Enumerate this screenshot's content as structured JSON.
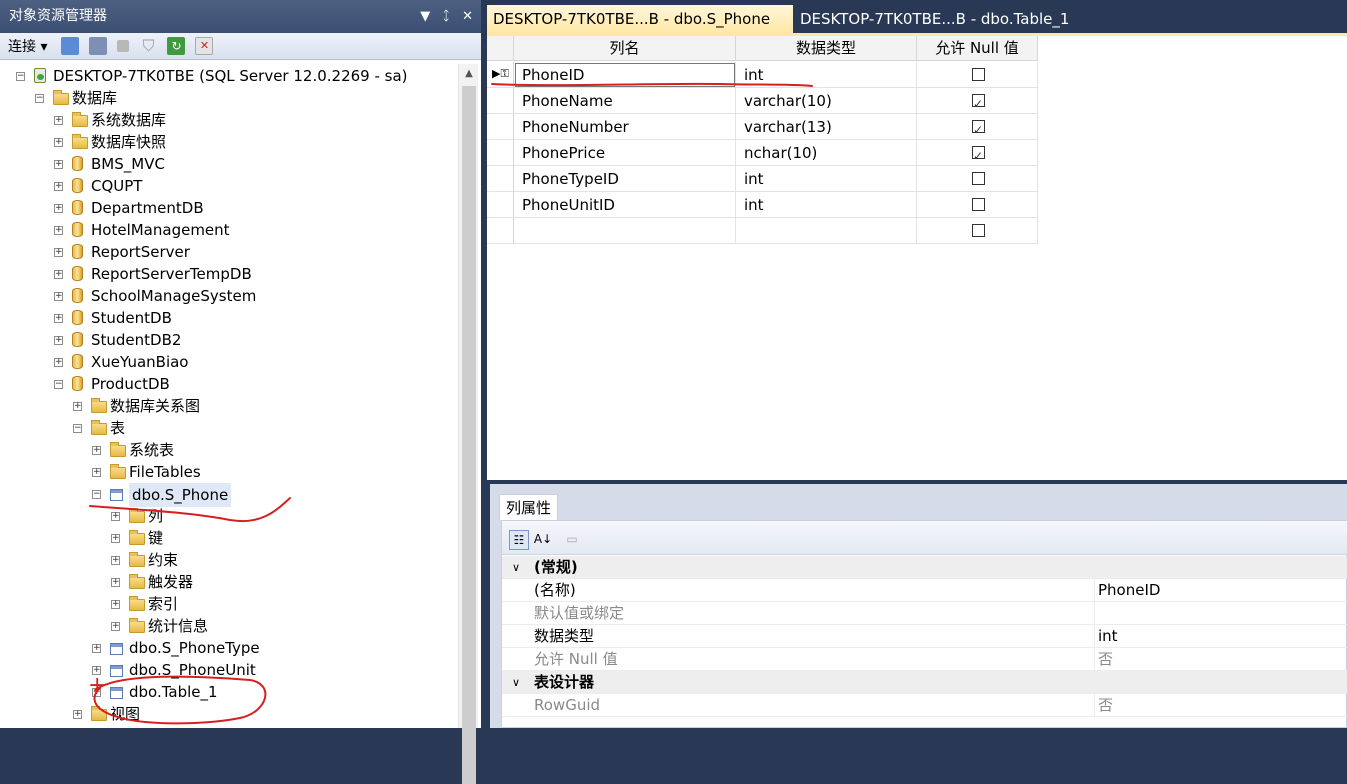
{
  "object_explorer": {
    "title": "对象资源管理器",
    "pin": "▾ ᛨ ✕",
    "toolbar": {
      "connect_label": "连接"
    },
    "tree": [
      {
        "label": "DESKTOP-7TK0TBE (SQL Server 12.0.2269 - sa)",
        "icon": "server-icon",
        "exp": "m"
      },
      {
        "label": "数据库",
        "icon": "folder-icon",
        "exp": "m"
      },
      {
        "label": "系统数据库",
        "icon": "folder-icon",
        "exp": "p"
      },
      {
        "label": "数据库快照",
        "icon": "folder-icon",
        "exp": "p"
      },
      {
        "label": "BMS_MVC",
        "icon": "database-icon",
        "exp": "p"
      },
      {
        "label": "CQUPT",
        "icon": "database-icon",
        "exp": "p"
      },
      {
        "label": "DepartmentDB",
        "icon": "database-icon",
        "exp": "p"
      },
      {
        "label": "HotelManagement",
        "icon": "database-icon",
        "exp": "p"
      },
      {
        "label": "ReportServer",
        "icon": "database-icon",
        "exp": "p"
      },
      {
        "label": "ReportServerTempDB",
        "icon": "database-icon",
        "exp": "p"
      },
      {
        "label": "SchoolManageSystem",
        "icon": "database-icon",
        "exp": "p"
      },
      {
        "label": "StudentDB",
        "icon": "database-icon",
        "exp": "p"
      },
      {
        "label": "StudentDB2",
        "icon": "database-icon",
        "exp": "p"
      },
      {
        "label": "XueYuanBiao",
        "icon": "database-icon",
        "exp": "p"
      },
      {
        "label": "ProductDB",
        "icon": "database-icon",
        "exp": "m"
      },
      {
        "label": "数据库关系图",
        "icon": "folder-icon",
        "exp": "p"
      },
      {
        "label": "表",
        "icon": "folder-icon",
        "exp": "m"
      },
      {
        "label": "系统表",
        "icon": "folder-icon",
        "exp": "p"
      },
      {
        "label": "FileTables",
        "icon": "folder-icon",
        "exp": "p"
      },
      {
        "label": "dbo.S_Phone",
        "icon": "table-icon",
        "exp": "m",
        "selected": true
      },
      {
        "label": "列",
        "icon": "folder-icon",
        "exp": "p"
      },
      {
        "label": "键",
        "icon": "folder-icon",
        "exp": "p"
      },
      {
        "label": "约束",
        "icon": "folder-icon",
        "exp": "p"
      },
      {
        "label": "触发器",
        "icon": "folder-icon",
        "exp": "p"
      },
      {
        "label": "索引",
        "icon": "folder-icon",
        "exp": "p"
      },
      {
        "label": "统计信息",
        "icon": "folder-icon",
        "exp": "p"
      },
      {
        "label": "dbo.S_PhoneType",
        "icon": "table-icon",
        "exp": "p"
      },
      {
        "label": "dbo.S_PhoneUnit",
        "icon": "table-icon",
        "exp": "p"
      },
      {
        "label": "dbo.Table_1",
        "icon": "table-icon",
        "exp": "p"
      },
      {
        "label": "视图",
        "icon": "folder-icon",
        "exp": "p"
      }
    ]
  },
  "tabs": [
    {
      "label": "DESKTOP-7TK0TBE...B - dbo.S_Phone",
      "active": true
    },
    {
      "label": "DESKTOP-7TK0TBE...B - dbo.Table_1",
      "active": false
    }
  ],
  "designer": {
    "headers": [
      "列名",
      "数据类型",
      "允许 Null 值"
    ],
    "rows": [
      {
        "name": "PhoneID",
        "type": "int",
        "allow_null": false,
        "primary_key": true
      },
      {
        "name": "PhoneName",
        "type": "varchar(10)",
        "allow_null": true
      },
      {
        "name": "PhoneNumber",
        "type": "varchar(13)",
        "allow_null": true
      },
      {
        "name": "PhonePrice",
        "type": "nchar(10)",
        "allow_null": true
      },
      {
        "name": "PhoneTypeID",
        "type": "int",
        "allow_null": false
      },
      {
        "name": "PhoneUnitID",
        "type": "int",
        "allow_null": false
      },
      {
        "name": "",
        "type": "",
        "allow_null": false
      }
    ]
  },
  "properties": {
    "tab_label": "列属性",
    "rows": [
      {
        "kind": "cat",
        "name": "(常规)"
      },
      {
        "kind": "prop",
        "name": "(名称)",
        "value": "PhoneID"
      },
      {
        "kind": "gray",
        "name": "默认值或绑定",
        "value": ""
      },
      {
        "kind": "prop",
        "name": "数据类型",
        "value": "int"
      },
      {
        "kind": "gray",
        "name": "允许 Null 值",
        "value": "否"
      },
      {
        "kind": "cat",
        "name": "表设计器"
      },
      {
        "kind": "gray",
        "name": "RowGuid",
        "value": "否"
      }
    ]
  },
  "annotation": {
    "mark": "+",
    "color": "#d62020"
  },
  "colors": {
    "chrome": "#293955",
    "active_tab": "#ffe8a6"
  }
}
